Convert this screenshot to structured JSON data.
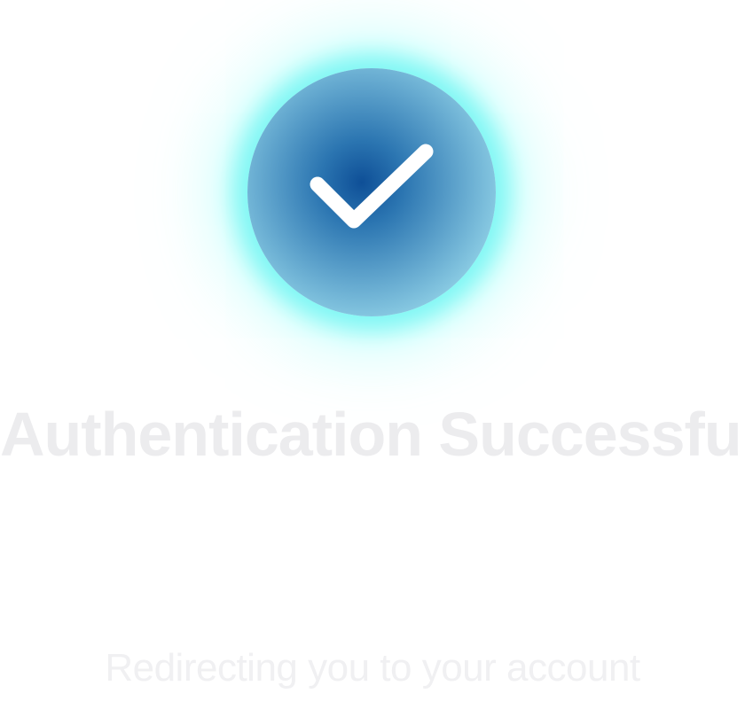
{
  "status": {
    "icon": "checkmark-icon",
    "title": "Authentication Successful",
    "subtitle": "Redirecting you to your account"
  },
  "colors": {
    "background": "#ffffff",
    "glow": "#7ff7f4",
    "circle_center": "#0e4f97",
    "circle_edge": "#a5def0",
    "checkmark": "#ffffff",
    "title_text": "#ececee",
    "subtitle_text": "#f0f0f2"
  }
}
